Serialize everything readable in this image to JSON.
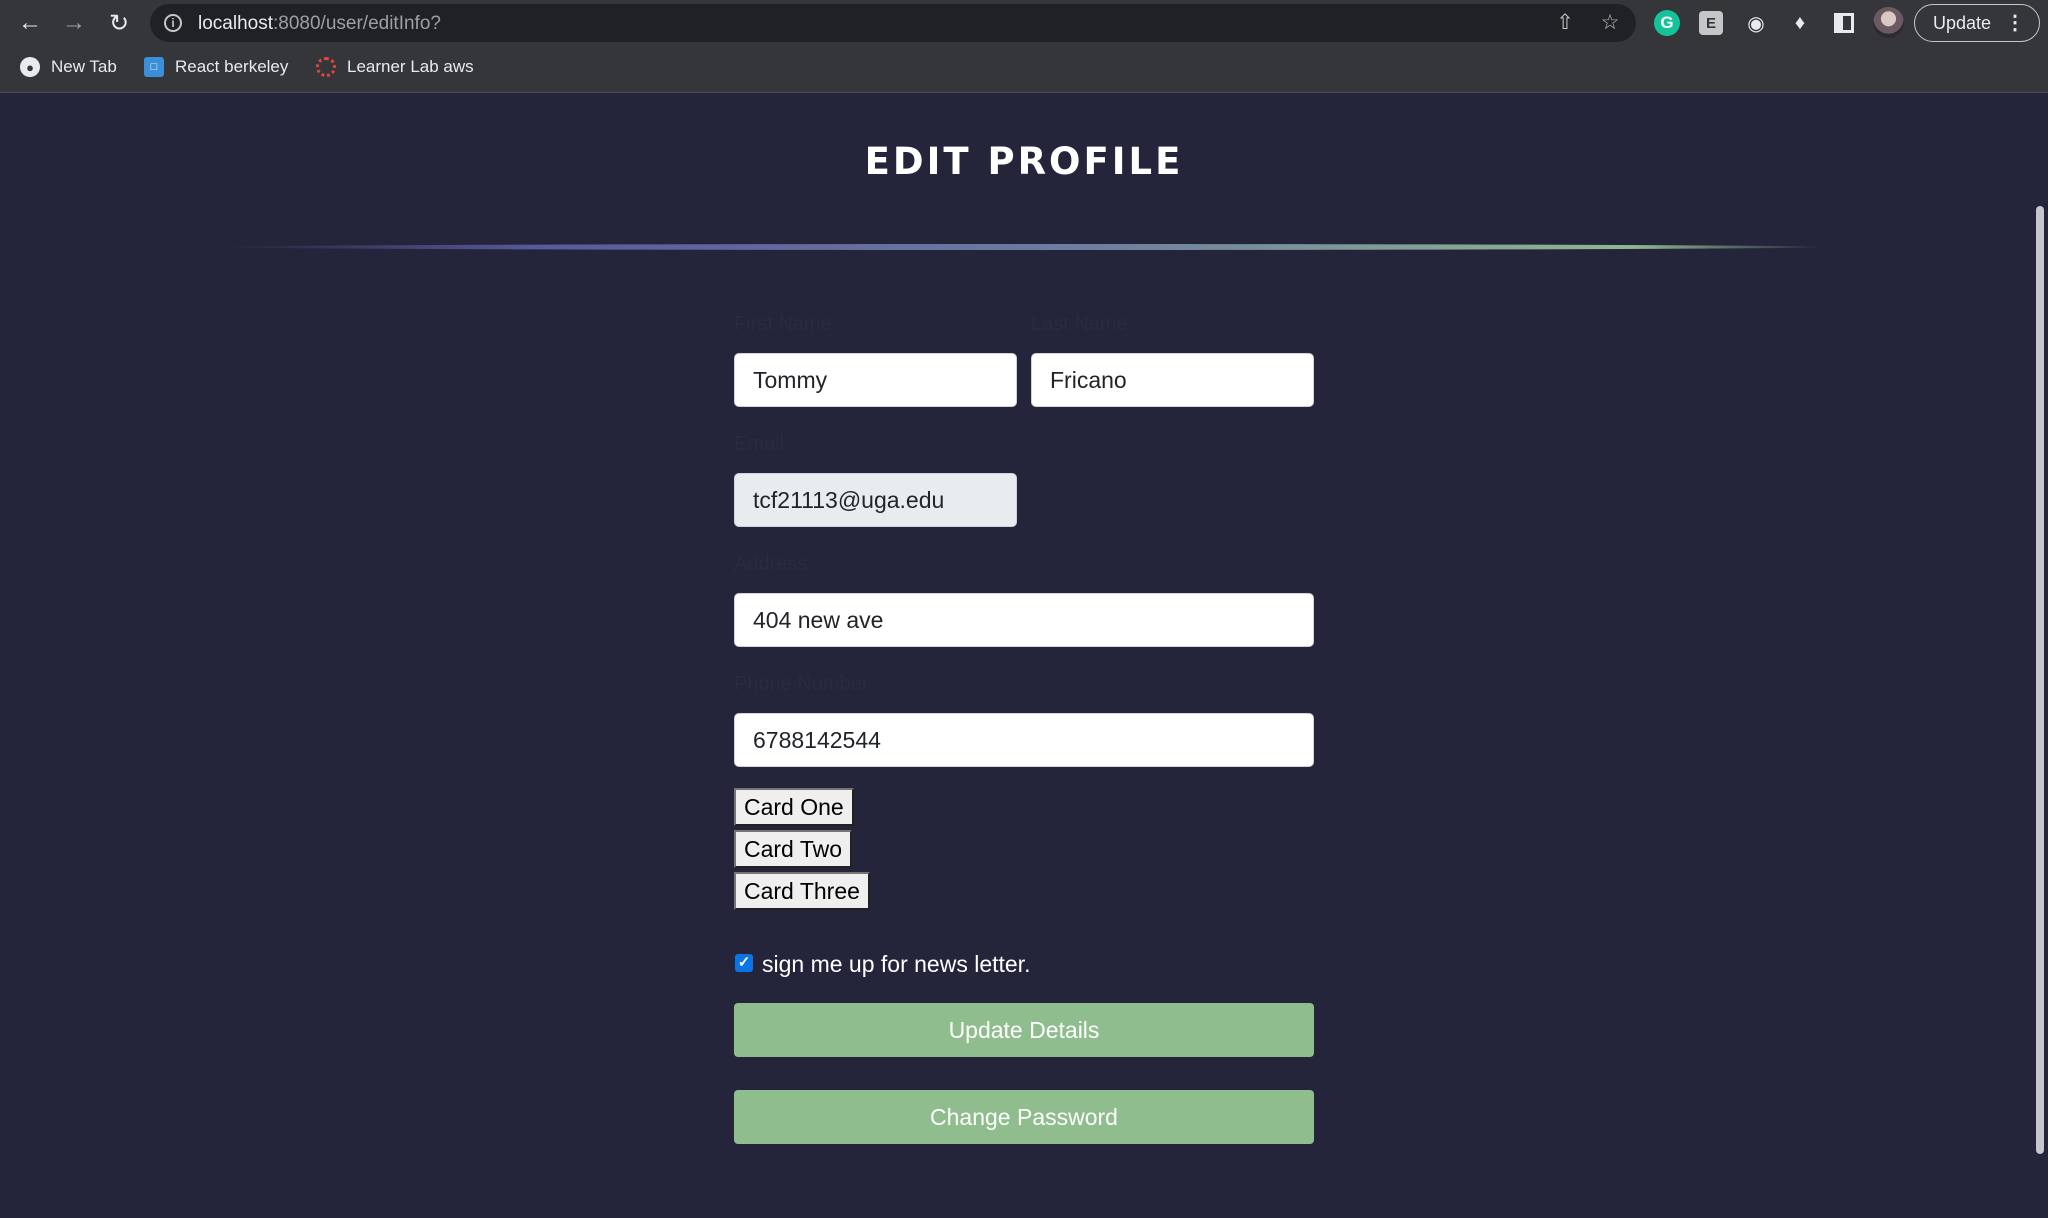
{
  "browser": {
    "url_host": "localhost",
    "url_path": ":8080/user/editInfo?",
    "update_label": "Update",
    "bookmarks": [
      {
        "label": "New Tab",
        "icon": "globe-icon"
      },
      {
        "label": "React berkeley",
        "icon": "monitor-icon"
      },
      {
        "label": "Learner Lab aws",
        "icon": "aws-icon"
      }
    ]
  },
  "page": {
    "title": "EDIT PROFILE"
  },
  "form": {
    "first_name": {
      "label": "First Name",
      "value": "Tommy"
    },
    "last_name": {
      "label": "Last Name",
      "value": "Fricano"
    },
    "email": {
      "label": "Email",
      "value": "tcf21113@uga.edu"
    },
    "address": {
      "label": "Address",
      "value": "404 new ave"
    },
    "phone": {
      "label": "Phone Number",
      "value": "6788142544"
    },
    "cards": [
      "Card One",
      "Card Two",
      "Card Three"
    ],
    "newsletter": {
      "label": "sign me up for news letter.",
      "checked": true
    },
    "update_button": "Update Details",
    "password_button": "Change Password"
  },
  "colors": {
    "page_background": "#24243a",
    "button_green": "#8fbd8d",
    "checkbox_blue": "#0b75e8"
  }
}
